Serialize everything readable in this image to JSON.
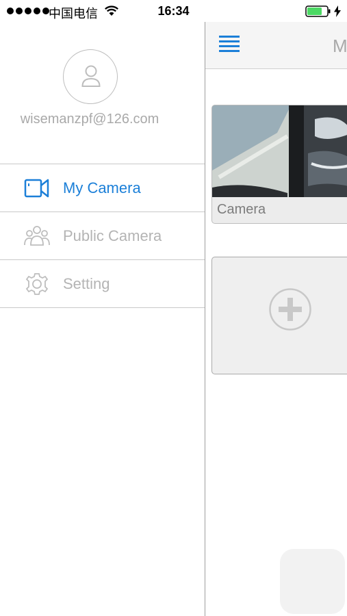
{
  "status_bar": {
    "carrier": "中国电信",
    "time": "16:34",
    "battery_color": "#4cd964"
  },
  "drawer": {
    "email": "wisemanzpf@126.com",
    "menu_items": [
      {
        "label": "My Camera",
        "icon": "video-camera-icon",
        "active": true
      },
      {
        "label": "Public Camera",
        "icon": "people-icon",
        "active": false
      },
      {
        "label": "Setting",
        "icon": "gear-icon",
        "active": false
      }
    ]
  },
  "main": {
    "title_partial": "M",
    "camera": {
      "name": "Camera"
    },
    "add_icon": "plus-circle-icon"
  },
  "colors": {
    "accent": "#1b7fd8",
    "muted_text": "#b4b4b4"
  }
}
